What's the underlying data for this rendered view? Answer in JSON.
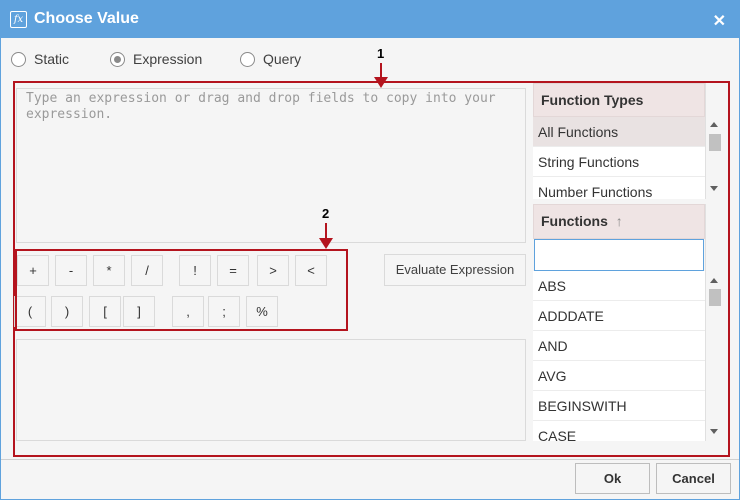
{
  "window": {
    "title": "Choose Value",
    "title_icon": "function-fx-icon",
    "close_icon": "close-icon"
  },
  "modes": [
    {
      "label": "Static",
      "selected": false
    },
    {
      "label": "Expression",
      "selected": true
    },
    {
      "label": "Query",
      "selected": false
    }
  ],
  "callouts": {
    "one": "1",
    "two": "2"
  },
  "expression": {
    "placeholder": "Type an expression or drag and drop fields to copy into your expression."
  },
  "operators": {
    "row1": [
      "+",
      "-",
      "*",
      "/",
      "!",
      "=",
      ">",
      "<"
    ],
    "row2": [
      "(",
      ")",
      "[",
      "]",
      ",",
      ";",
      "%"
    ]
  },
  "evaluate_label": "Evaluate Expression",
  "function_types": {
    "header": "Function Types",
    "items": [
      "All Functions",
      "String Functions",
      "Number Functions"
    ],
    "selected_index": 0
  },
  "functions": {
    "header": "Functions",
    "sort_icon": "sort-ascending-icon",
    "search_value": "",
    "items": [
      "ABS",
      "ADDDATE",
      "AND",
      "AVG",
      "BEGINSWITH",
      "CASE"
    ]
  },
  "footer": {
    "ok_label": "Ok",
    "cancel_label": "Cancel"
  },
  "colors": {
    "titlebar": "#5fa2dd",
    "annotation": "#b4141e",
    "panel_header": "#efe4e4"
  }
}
